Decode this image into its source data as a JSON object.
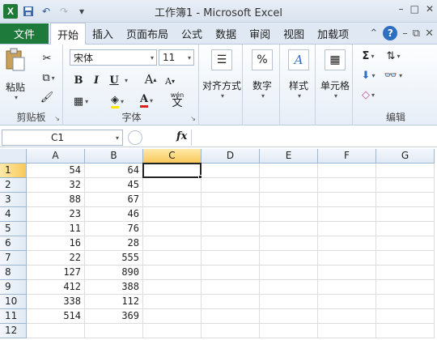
{
  "window": {
    "title": "工作簿1 - Microsoft Excel",
    "logo": "X",
    "controls": [
      "–",
      "□",
      "✕"
    ]
  },
  "qat": {
    "undo": "↶",
    "redo": "↷",
    "dropdown": "▾"
  },
  "tabs": {
    "file": "文件",
    "items": [
      "开始",
      "插入",
      "页面布局",
      "公式",
      "数据",
      "审阅",
      "视图",
      "加载项"
    ],
    "active": "开始",
    "help": "?"
  },
  "ribbon": {
    "clipboard": {
      "label": "剪贴板",
      "paste": "粘贴"
    },
    "font": {
      "label": "字体",
      "name": "宋体",
      "size": "11",
      "bold": "B",
      "italic": "I",
      "underline": "U",
      "grow": "A",
      "shrink": "A",
      "font_color_letter": "A",
      "phonetic": "wén",
      "phonetic_char": "文"
    },
    "alignment": {
      "label": "对齐方式"
    },
    "number": {
      "label": "数字",
      "symbol": "%"
    },
    "styles": {
      "label": "样式"
    },
    "cells": {
      "label": "单元格"
    },
    "editing": {
      "label": "编辑",
      "sum": "Σ"
    }
  },
  "formula_bar": {
    "name_box": "C1",
    "fx": "fx",
    "formula": ""
  },
  "sheet": {
    "columns": [
      "A",
      "B",
      "C",
      "D",
      "E",
      "F",
      "G"
    ],
    "selected_cell": "C1",
    "rows": [
      {
        "n": "1",
        "a": "54",
        "b": "64"
      },
      {
        "n": "2",
        "a": "32",
        "b": "45"
      },
      {
        "n": "3",
        "a": "88",
        "b": "67"
      },
      {
        "n": "4",
        "a": "23",
        "b": "46"
      },
      {
        "n": "5",
        "a": "11",
        "b": "76"
      },
      {
        "n": "6",
        "a": "16",
        "b": "28"
      },
      {
        "n": "7",
        "a": "22",
        "b": "555"
      },
      {
        "n": "8",
        "a": "127",
        "b": "890"
      },
      {
        "n": "9",
        "a": "412",
        "b": "388"
      },
      {
        "n": "10",
        "a": "338",
        "b": "112"
      },
      {
        "n": "11",
        "a": "514",
        "b": "369"
      },
      {
        "n": "12",
        "a": "",
        "b": ""
      }
    ]
  },
  "colors": {
    "file_tab": "#1e7a3b",
    "selection_header": "#f8c95b",
    "header_border": "#9eb6ce"
  }
}
